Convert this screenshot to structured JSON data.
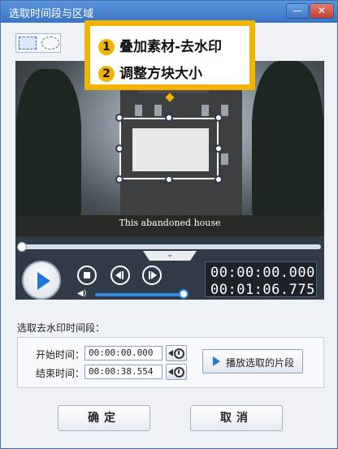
{
  "window": {
    "title": "选取时间段与区域",
    "minimize_label": "—",
    "close_label": "✕"
  },
  "callout": {
    "tip1_number": "1",
    "tip1_text": "叠加素材-去水印",
    "tip2_number": "2",
    "tip2_text": "调整方块大小"
  },
  "video": {
    "subtitle": "This abandoned house"
  },
  "player": {
    "seek_progress": 0.0,
    "volume_level": 0.95,
    "current_time": "00:00:00.000",
    "total_time": "00:01:06.775",
    "collapse_glyph": "⌄"
  },
  "range": {
    "section_title": "选取去水印时间段：",
    "start_label": "开始时间：",
    "start_value": "00:00:00.000",
    "end_label": "结束时间：",
    "end_value": "00:00:38.554",
    "play_selection_label": "播放选取的片段"
  },
  "buttons": {
    "ok_label": "确定",
    "cancel_label": "取消"
  },
  "icons": {
    "tool_rect": "rect-select-icon",
    "tool_ellipse": "ellipse-select-icon",
    "play": "play-icon",
    "stop": "stop-icon",
    "prev": "prev-frame-icon",
    "next": "next-frame-icon",
    "volume": "volume-icon",
    "set_time": "set-time-icon"
  },
  "colors": {
    "accent": "#f2b400",
    "titlebar": "#3b74c4",
    "player_bg": "#313a47",
    "play_blue": "#1e7ad6"
  }
}
